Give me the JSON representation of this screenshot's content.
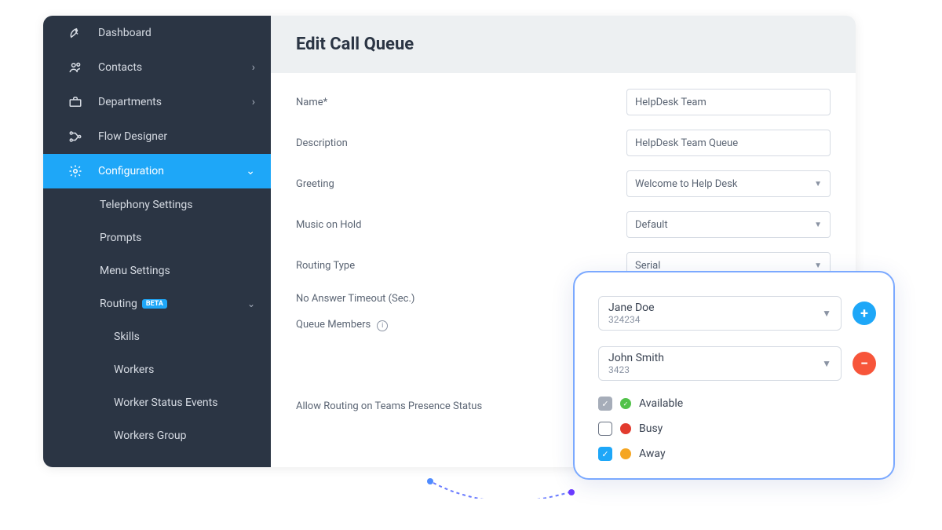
{
  "sidebar": {
    "items": [
      {
        "label": "Dashboard",
        "icon": "rocket"
      },
      {
        "label": "Contacts",
        "icon": "users",
        "chev": "right"
      },
      {
        "label": "Departments",
        "icon": "briefcase",
        "chev": "right"
      },
      {
        "label": "Flow Designer",
        "icon": "flow"
      },
      {
        "label": "Configuration",
        "icon": "gear",
        "chev": "down",
        "active": true
      }
    ],
    "config_subs": [
      {
        "label": "Telephony Settings"
      },
      {
        "label": "Prompts"
      },
      {
        "label": "Menu Settings"
      },
      {
        "label": "Routing",
        "badge": "BETA",
        "chev": "down"
      }
    ],
    "routing_subs": [
      {
        "label": "Skills"
      },
      {
        "label": "Workers"
      },
      {
        "label": "Worker Status Events"
      },
      {
        "label": "Workers Group"
      }
    ]
  },
  "header": {
    "title": "Edit Call Queue"
  },
  "form": {
    "name_label": "Name*",
    "name_value": "HelpDesk Team",
    "desc_label": "Description",
    "desc_value": "HelpDesk Team Queue",
    "greeting_label": "Greeting",
    "greeting_value": "Welcome to Help Desk",
    "moh_label": "Music on Hold",
    "moh_value": "Default",
    "routing_label": "Routing Type",
    "routing_value": "Serial",
    "timeout_label": "No Answer Timeout (Sec.)",
    "members_label": "Queue Members",
    "presence_label": "Allow Routing on Teams Presence Status"
  },
  "members": [
    {
      "name": "Jane Doe",
      "id": "324234",
      "action": "add"
    },
    {
      "name": "John Smith",
      "id": "3423",
      "action": "remove"
    }
  ],
  "statuses": [
    {
      "label": "Available",
      "checkbox": "gray",
      "dot": "green",
      "checked": true
    },
    {
      "label": "Busy",
      "checkbox": "empty",
      "dot": "red",
      "checked": false
    },
    {
      "label": "Away",
      "checkbox": "blue",
      "dot": "amber",
      "checked": true
    }
  ],
  "colors": {
    "accent": "#1ea7f8",
    "danger": "#f7553a"
  }
}
